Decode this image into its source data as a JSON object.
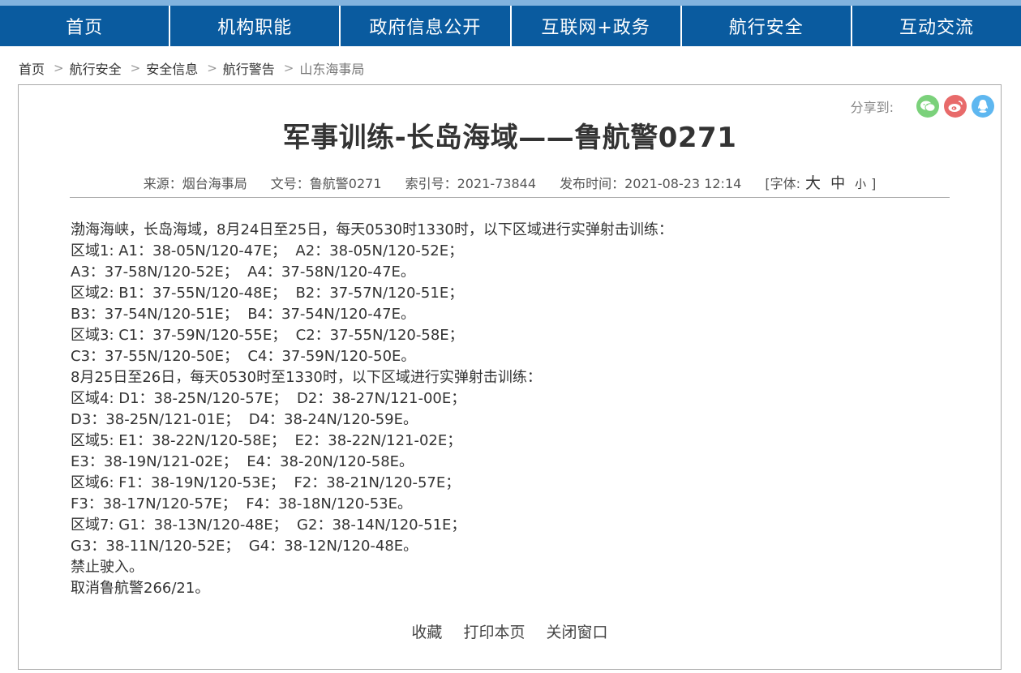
{
  "nav": {
    "items": [
      "首页",
      "机构职能",
      "政府信息公开",
      "互联网+政务",
      "航行安全",
      "互动交流"
    ],
    "background": "#0a5b9f"
  },
  "breadcrumb": {
    "items": [
      "首页",
      "航行安全",
      "安全信息",
      "航行警告",
      "山东海事局"
    ],
    "separator": ">"
  },
  "share": {
    "label": "分享到:",
    "icons": [
      "wechat-icon",
      "weibo-icon",
      "qq-icon"
    ],
    "colors": {
      "wechat": "#7bd17b",
      "weibo": "#e86a6a",
      "qq": "#5eb7f0"
    }
  },
  "article": {
    "title": "军事训练-长岛海域——鲁航警0271",
    "meta": {
      "source": "来源：烟台海事局",
      "doc_no": "文号：鲁航警0271",
      "index_no": "索引号：2021-73844",
      "publish_time": "发布时间：2021-08-23 12:14",
      "font_label": "[字体:",
      "font_big": "大",
      "font_mid": "中",
      "font_small": "小",
      "font_close": "]"
    },
    "lines": [
      "渤海海峡，长岛海域，8月24日至25日，每天0530时1330时，以下区域进行实弹射击训练：",
      "区域1: A1：38-05N/120-47E；  A2：38-05N/120-52E；",
      "A3：37-58N/120-52E；  A4：37-58N/120-47E。",
      "区域2: B1：37-55N/120-48E；  B2：37-57N/120-51E；",
      "B3：37-54N/120-51E；  B4：37-54N/120-47E。",
      "区域3: C1：37-59N/120-55E；  C2：37-55N/120-58E；",
      "C3：37-55N/120-50E；  C4：37-59N/120-50E。",
      "8月25日至26日，每天0530时至1330时，以下区域进行实弹射击训练：",
      "区域4: D1：38-25N/120-57E；  D2：38-27N/121-00E；",
      "D3：38-25N/121-01E；  D4：38-24N/120-59E。",
      "区域5: E1：38-22N/120-58E；  E2：38-22N/121-02E；",
      "E3：38-19N/121-02E；  E4：38-20N/120-58E。",
      "区域6: F1：38-19N/120-53E；  F2：38-21N/120-57E；",
      "F3：38-17N/120-57E；  F4：38-18N/120-53E。",
      "区域7: G1：38-13N/120-48E；  G2：38-14N/120-51E；",
      "G3：38-11N/120-52E；  G4：38-12N/120-48E。",
      "禁止驶入。",
      "取消鲁航警266/21。"
    ]
  },
  "actions": {
    "favorite": "收藏",
    "print": "打印本页",
    "close": "关闭窗口"
  }
}
